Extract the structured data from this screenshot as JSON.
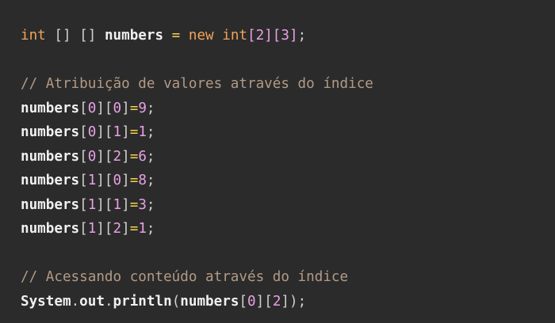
{
  "code": {
    "line1": {
      "type": "int",
      "brackets": " [] [] ",
      "name": "numbers",
      "op": " = ",
      "new_kw": "new",
      "type2": "int",
      "dims": "[2][3]",
      "semi": ";"
    },
    "comment1": "// Atribuição de valores através do índice",
    "assignments": [
      {
        "name": "numbers",
        "i": "0",
        "j": "0",
        "val": "9"
      },
      {
        "name": "numbers",
        "i": "0",
        "j": "1",
        "val": "1"
      },
      {
        "name": "numbers",
        "i": "0",
        "j": "2",
        "val": "6"
      },
      {
        "name": "numbers",
        "i": "1",
        "j": "0",
        "val": "8"
      },
      {
        "name": "numbers",
        "i": "1",
        "j": "1",
        "val": "3"
      },
      {
        "name": "numbers",
        "i": "1",
        "j": "2",
        "val": "1"
      }
    ],
    "comment2": "// Acessando conteúdo através do índice",
    "print_line": {
      "obj": "System",
      "dot1": ".",
      "field": "out",
      "dot2": ".",
      "method": "println",
      "open": "(",
      "arg": "numbers",
      "i": "0",
      "j": "2",
      "close": ");"
    }
  }
}
